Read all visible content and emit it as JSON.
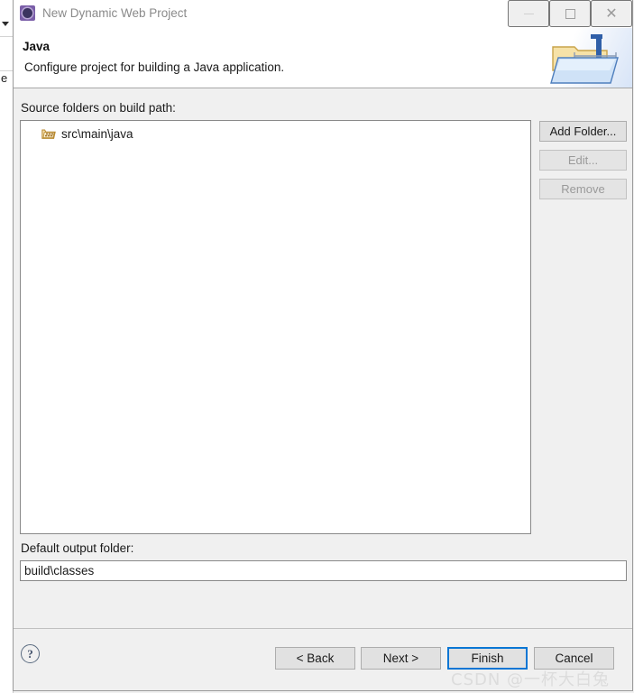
{
  "window": {
    "title": "New Dynamic Web Project",
    "icon": "eclipse-wizard-icon",
    "minimize_label": "—",
    "maximize_label": "",
    "close_label": "✕"
  },
  "header": {
    "title": "Java",
    "description": "Configure project for building a Java application.",
    "banner_icon": "java-folder-banner-icon"
  },
  "main": {
    "source_folders_label": "Source folders on build path:",
    "source_folders": [
      {
        "label": "src\\main\\java",
        "icon": "package-folder-icon"
      }
    ],
    "buttons": [
      {
        "name": "add-folder",
        "label": "Add Folder...",
        "enabled": true
      },
      {
        "name": "edit",
        "label": "Edit...",
        "enabled": false
      },
      {
        "name": "remove",
        "label": "Remove",
        "enabled": false
      }
    ],
    "output_folder_label": "Default output folder:",
    "output_folder_value": "build\\classes",
    "output_folder_placeholder": ""
  },
  "footer": {
    "help_label": "?",
    "back_label": "< Back",
    "next_label": "Next >",
    "finish_label": "Finish",
    "cancel_label": "Cancel"
  },
  "watermark": {
    "text": "CSDN @一杯大白兔"
  },
  "background": {
    "edge_letter": "e"
  },
  "colors": {
    "accent_blue": "#0a76d4",
    "dialog_bg": "#f0f0f0",
    "button_bg": "#e1e1e1",
    "border": "#898989",
    "title_text": "#8a8a8a",
    "disabled_text": "#9a9a9a",
    "icon_purple": "#7a5ea8",
    "watermark": "#dcdcdc"
  }
}
